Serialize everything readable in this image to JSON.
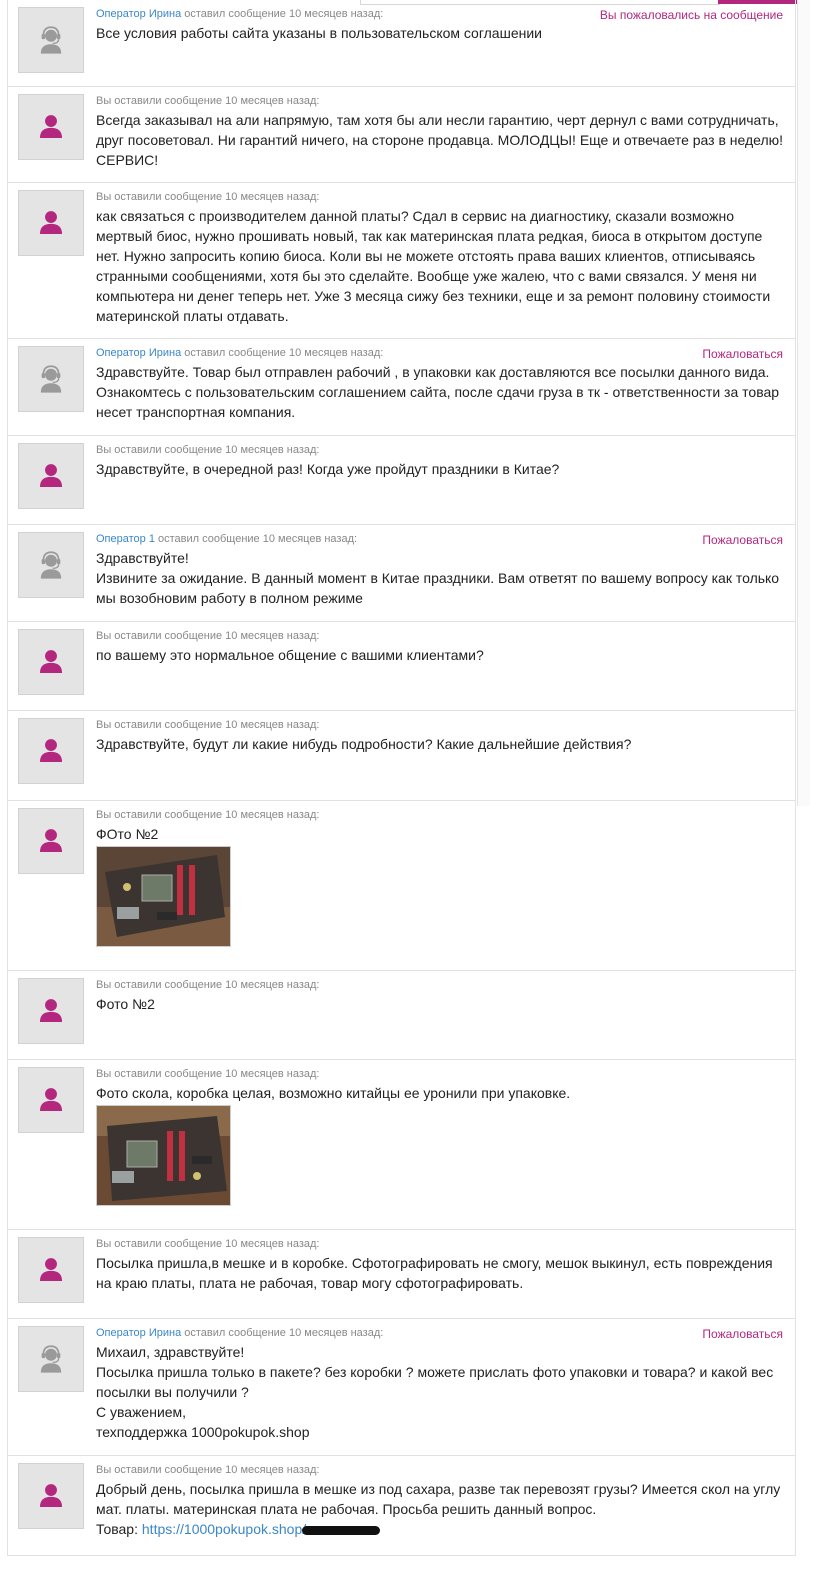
{
  "messages": [
    {
      "kind": "op",
      "author": "Оператор Ирина",
      "action": "оставил сообщение 10 месяцев назад:",
      "report": "Вы пожаловались на сообщение",
      "text": "Все условия работы сайта указаны в пользовательском соглашении"
    },
    {
      "kind": "user",
      "meta": "Вы оставили сообщение 10 месяцев назад:",
      "text": "Всегда заказывал на али напрямую, там хотя бы али несли гарантию, черт дернул с вами сотрудничать,\nдруг посоветовал. Ни гарантий ничего, на стороне продавца. МОЛОДЦЫ! Еще и отвечаете раз в неделю!\nСЕРВИС!"
    },
    {
      "kind": "user",
      "meta": "Вы оставили сообщение 10 месяцев назад:",
      "text": "как связаться с производителем данной платы? Сдал в сервис на диагностику, сказали возможно\nмертвый биос, нужно прошивать новый, так как материнская плата редкая, биоса в открытом доступе\nнет. Нужно запросить копию биоса. Коли вы не можете отстоять права ваших клиентов, отписываясь\nстранными сообщениями, хотя бы это сделайте. Вообще уже жалею, что с вами связался. У меня ни\nкомпьютера ни денег теперь нет. Уже 3 месяца сижу без техники, еще и за ремонт половину стоимости\nматеринской платы отдавать."
    },
    {
      "kind": "op",
      "author": "Оператор Ирина",
      "action": "оставил сообщение 10 месяцев назад:",
      "report": "Пожаловаться",
      "text": "Здравствуйте. Товар был отправлен рабочий , в упаковки как доставляются все посылки данного вида.\nОзнакомтесь с пользовательским соглашением сайта, после сдачи груза в тк - ответственности за товар\nнесет транспортная компания."
    },
    {
      "kind": "user",
      "meta": "Вы оставили сообщение 10 месяцев назад:",
      "text": "Здравствуйте, в очередной раз! Когда уже пройдут праздники в Китае?"
    },
    {
      "kind": "op",
      "author": "Оператор 1",
      "action": "оставил сообщение 10 месяцев назад:",
      "report": "Пожаловаться",
      "text": "Здравствуйте!\nИзвините за ожидание. В данный момент в Китае праздники. Вам ответят по вашему вопросу как только\nмы возобновим работу в полном режиме"
    },
    {
      "kind": "user",
      "meta": "Вы оставили сообщение 10 месяцев назад:",
      "text": "по вашему это нормальное общение с вашими клиентами?"
    },
    {
      "kind": "user",
      "meta": "Вы оставили сообщение 10 месяцев назад:",
      "text": "Здравствуйте, будут ли какие нибудь подробности? Какие дальнейшие действия?"
    },
    {
      "kind": "user",
      "meta": "Вы оставили сообщение 10 месяцев назад:",
      "text": "ФОто №2",
      "photo": "motherboard-photo-1"
    },
    {
      "kind": "user",
      "meta": "Вы оставили сообщение 10 месяцев назад:",
      "text": "Фото №2"
    },
    {
      "kind": "user",
      "meta": "Вы оставили сообщение 10 месяцев назад:",
      "text": "Фото скола, коробка целая, возможно китайцы ее уронили при упаковке.",
      "photo": "motherboard-photo-2"
    },
    {
      "kind": "user",
      "meta": "Вы оставили сообщение 10 месяцев назад:",
      "text": "Посылка пришла,в мешке и в коробке. Сфотографировать не смогу, мешок выкинул, есть повреждения\nна краю платы, плата не рабочая, товар могу сфотографировать."
    },
    {
      "kind": "op",
      "author": "Оператор Ирина",
      "action": "оставил сообщение 10 месяцев назад:",
      "report": "Пожаловаться",
      "text": "Михаил, здравствуйте!\nПосылка пришла только в пакете? без коробки ? можете прислать фото упаковки и товара? и какой вес\nпосылки вы получили ?\nС уважением,\nтехподдержка 1000pokupok.shop"
    },
    {
      "kind": "user",
      "meta": "Вы оставили сообщение 10 месяцев назад:",
      "text": "Добрый день, посылка пришла в мешке из под сахара, разве так перевозят грузы? Имеется скол на углу\nмат. платы. материнская плата не рабочая. Просьба решить данный вопрос.",
      "product_label": "Товар: ",
      "product_link": "https://1000pokupok.shop/"
    }
  ],
  "colors": {
    "accent": "#b3277f",
    "link": "#3a87c8",
    "operator_icon": "#9a9a9a"
  }
}
